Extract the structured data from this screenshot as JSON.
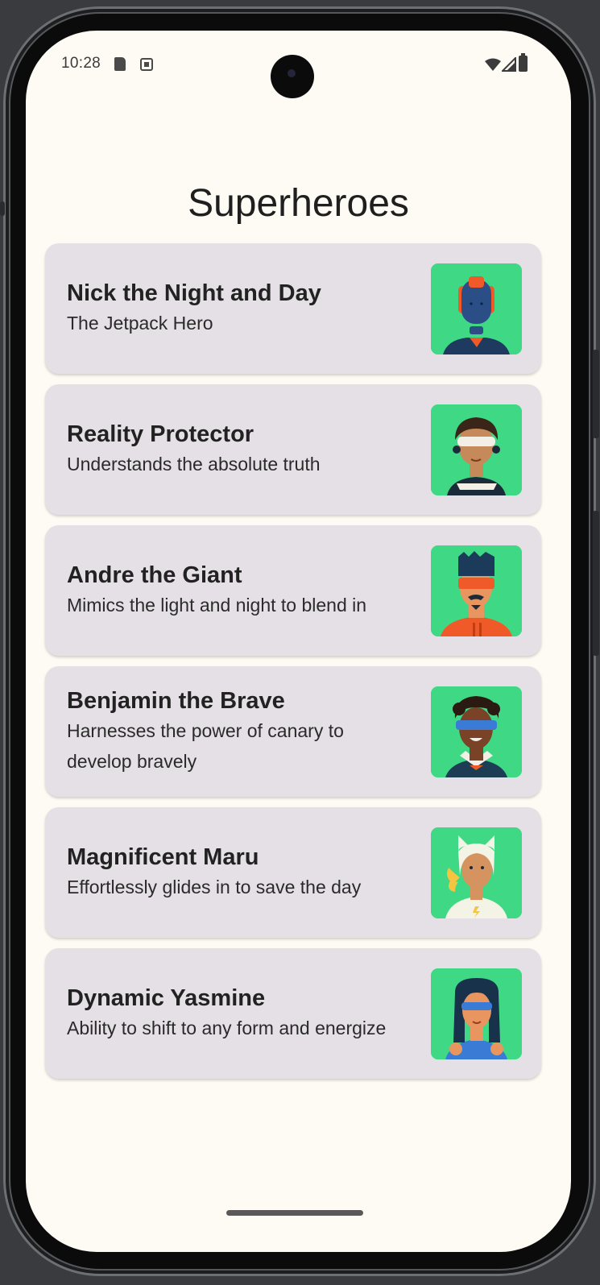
{
  "status_bar": {
    "time": "10:28"
  },
  "app": {
    "title": "Superheroes"
  },
  "heroes": [
    {
      "name": "Nick the Night and Day",
      "description": "The Jetpack Hero",
      "avatar_icon": "hero-avatar-icon"
    },
    {
      "name": "Reality Protector",
      "description": "Understands the absolute truth",
      "avatar_icon": "hero-avatar-icon"
    },
    {
      "name": "Andre the Giant",
      "description": "Mimics the light and night to blend in",
      "avatar_icon": "hero-avatar-icon"
    },
    {
      "name": "Benjamin the Brave",
      "description": "Harnesses the power of canary to develop bravely",
      "avatar_icon": "hero-avatar-icon"
    },
    {
      "name": "Magnificent Maru",
      "description": "Effortlessly glides in to save the day",
      "avatar_icon": "hero-avatar-icon"
    },
    {
      "name": "Dynamic Yasmine",
      "description": "Ability to shift to any form and energize",
      "avatar_icon": "hero-avatar-icon"
    }
  ],
  "colors": {
    "screen_background": "#fefbf4",
    "card_background": "#e5e0e6",
    "avatar_background": "#3fd985"
  }
}
